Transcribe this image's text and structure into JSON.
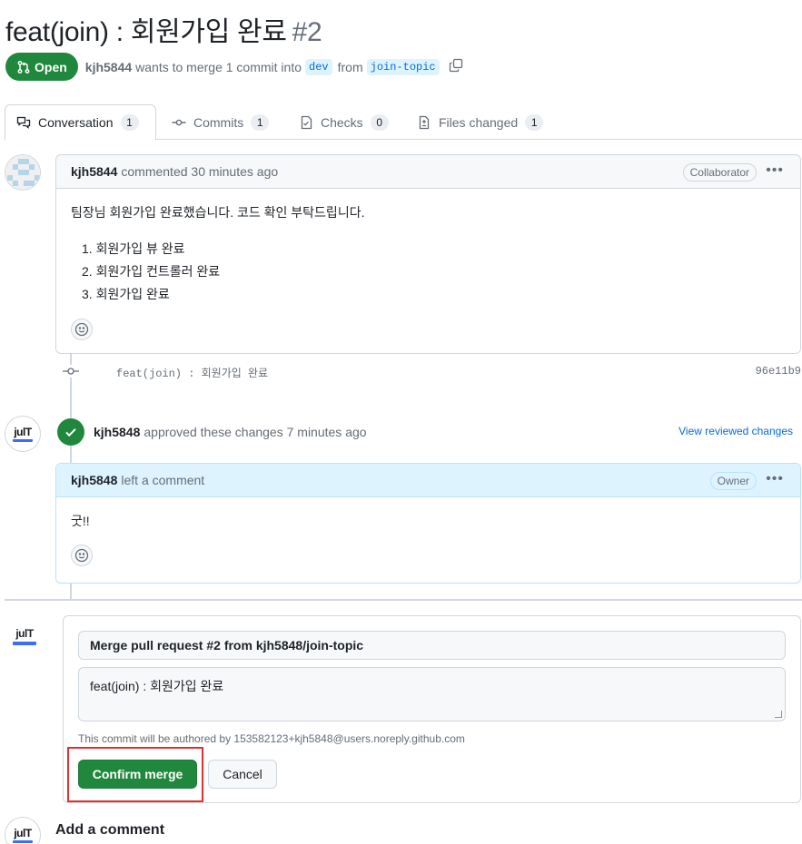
{
  "pr": {
    "title": "feat(join) : 회원가입 완료",
    "number": "#2",
    "state": "Open",
    "author": "kjh5844",
    "merge_text_1": "wants to merge 1 commit into",
    "base_branch": "dev",
    "merge_text_2": "from",
    "head_branch": "join-topic"
  },
  "tabs": [
    {
      "label": "Conversation",
      "count": "1",
      "icon": "comment-discussion-icon"
    },
    {
      "label": "Commits",
      "count": "1",
      "icon": "git-commit-icon"
    },
    {
      "label": "Checks",
      "count": "0",
      "icon": "checklist-icon"
    },
    {
      "label": "Files changed",
      "count": "1",
      "icon": "file-diff-icon"
    }
  ],
  "comment1": {
    "author": "kjh5844",
    "action": "commented 30 minutes ago",
    "role": "Collaborator",
    "body": "팀장님 회원가입 완료했습니다. 코드 확인 부탁드립니다.",
    "items": [
      "1. 회원가입 뷰 완료",
      "2. 회원가입 컨트롤러 완료",
      "3. 회원가입 완료"
    ]
  },
  "commit": {
    "message": "feat(join) : 회원가입 완료",
    "sha": "96e11b9"
  },
  "review": {
    "author": "kjh5848",
    "action": "approved these changes 7 minutes ago",
    "link": "View reviewed changes"
  },
  "comment2": {
    "author": "kjh5848",
    "action": "left a comment",
    "role": "Owner",
    "body": "굿!!"
  },
  "avatar": {
    "logo_text": "julT"
  },
  "merge": {
    "title_value": "Merge pull request #2 from kjh5848/join-topic",
    "message_value": "feat(join) : 회원가입 완료",
    "author_note": "This commit will be authored by 153582123+kjh5848@users.noreply.github.com",
    "confirm_label": "Confirm merge",
    "cancel_label": "Cancel"
  },
  "add_comment": {
    "title": "Add a comment"
  },
  "colors": {
    "green": "#1f883d",
    "blue_link": "#0969da",
    "highlight": "#e5302e"
  }
}
